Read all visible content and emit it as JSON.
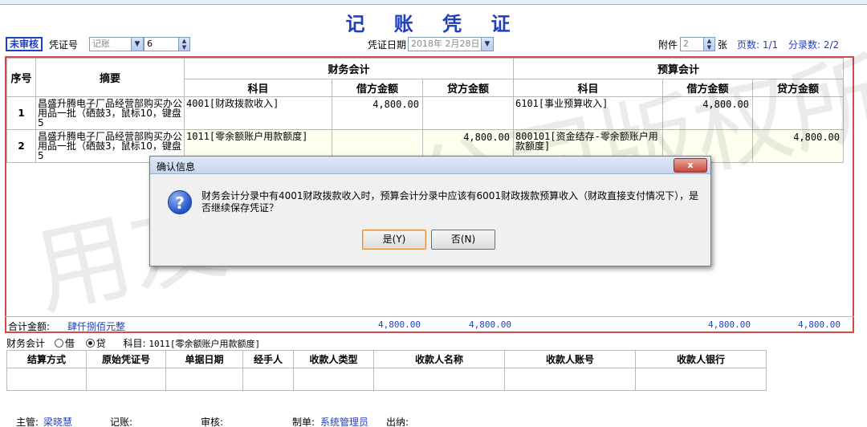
{
  "title": "记 账 凭 证",
  "header": {
    "status": "未审核",
    "voucher_no_label": "凭证号",
    "voucher_type": "记账",
    "voucher_no": "6",
    "date_label": "凭证日期",
    "date": "2018年 2月28日",
    "attach_label": "附件",
    "attach_count": "2",
    "attach_unit": "张",
    "page_info": "页数: 1/1",
    "entry_info": "分录数: 2/2"
  },
  "table": {
    "col_seq": "序号",
    "col_summary": "摘要",
    "group_fin": "财务会计",
    "group_budget": "预算会计",
    "col_subject": "科目",
    "col_debit": "借方金额",
    "col_credit": "贷方金额",
    "rows": [
      {
        "seq": "1",
        "summary": "昌盛升腾电子厂品经营部购买办公用品一批（硒鼓3，鼠标10，键盘5",
        "fin_subject": "4001[财政拨款收入]",
        "fin_debit": "4,800.00",
        "fin_credit": "",
        "bud_subject": "6101[事业预算收入]",
        "bud_debit": "4,800.00",
        "bud_credit": ""
      },
      {
        "seq": "2",
        "summary": "昌盛升腾电子厂品经营部购买办公用品一批（硒鼓3，鼠标10，键盘5",
        "fin_subject": "1011[零余额账户用款额度]",
        "fin_debit": "",
        "fin_credit": "4,800.00",
        "bud_subject": "800101[资金结存-零余额账户用款额度]",
        "bud_debit": "",
        "bud_credit": "4,800.00"
      }
    ]
  },
  "totals": {
    "label": "合计金额:",
    "words": "肆仟捌佰元整",
    "fin_debit": "4,800.00",
    "fin_credit": "4,800.00",
    "bud_debit": "4,800.00",
    "bud_credit": "4,800.00"
  },
  "entry_line": {
    "mode_label": "财务会计",
    "debit_label": "借",
    "credit_label": "贷",
    "subject_label": "科目:",
    "subject_value": "1011[零余额账户用款额度]"
  },
  "pay_table": {
    "headers": [
      "结算方式",
      "原始凭证号",
      "单据日期",
      "经手人",
      "收款人类型",
      "收款人名称",
      "收款人账号",
      "收款人银行"
    ]
  },
  "footer": {
    "director_label": "主管:",
    "director": "梁晓慧",
    "bookkeeper_label": "记账:",
    "reviewer_label": "审核:",
    "maker_label": "制单:",
    "maker": "系统管理员",
    "cashier_label": "出纳:"
  },
  "watermark": "用友政务公司版权所有",
  "dialog": {
    "title": "确认信息",
    "close": "x",
    "message": "财务会计分录中有4001财政拨款收入时，预算会计分录中应该有6001财政拨款预算收入（财政直接支付情况下），是否继续保存凭证？",
    "yes": "是(Y)",
    "no": "否(N)"
  },
  "colors": {
    "title_blue": "#1f3fc2",
    "grid_border": "#d34a4a"
  }
}
